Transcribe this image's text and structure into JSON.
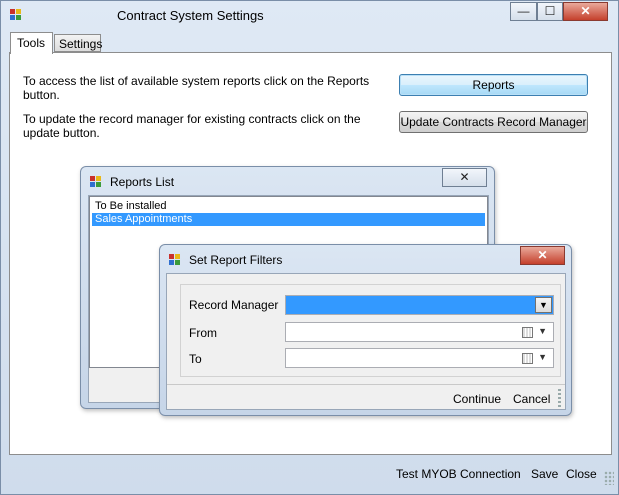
{
  "window": {
    "title": "Contract System Settings",
    "minimize_glyph": "—",
    "maximize_glyph": "☐",
    "close_glyph": "✕"
  },
  "tabs": [
    {
      "label": "Tools",
      "selected": true
    },
    {
      "label": "Settings",
      "selected": false
    }
  ],
  "tools_panel": {
    "reports_text": "To access the list of available system reports click on the Reports button.",
    "reports_button": "Reports",
    "update_text_line1": "To update the record manager for existing contracts click on the",
    "update_text_line2": "update button.",
    "update_button": "Update Contracts Record Manager"
  },
  "reports_list": {
    "title": "Reports List",
    "close_glyph": "✕",
    "items": [
      {
        "label": "To Be installed",
        "selected": false
      },
      {
        "label": "Sales Appointments",
        "selected": true
      }
    ]
  },
  "report_filters": {
    "title": "Set Report Filters",
    "close_glyph": "✕",
    "record_manager_label": "Record Manager",
    "record_manager_value": "",
    "from_label": "From",
    "from_value": "",
    "to_label": "To",
    "to_value": "",
    "continue_label": "Continue",
    "cancel_label": "Cancel"
  },
  "status_bar": {
    "test_connection": "Test MYOB Connection",
    "save": "Save",
    "close": "Close"
  }
}
